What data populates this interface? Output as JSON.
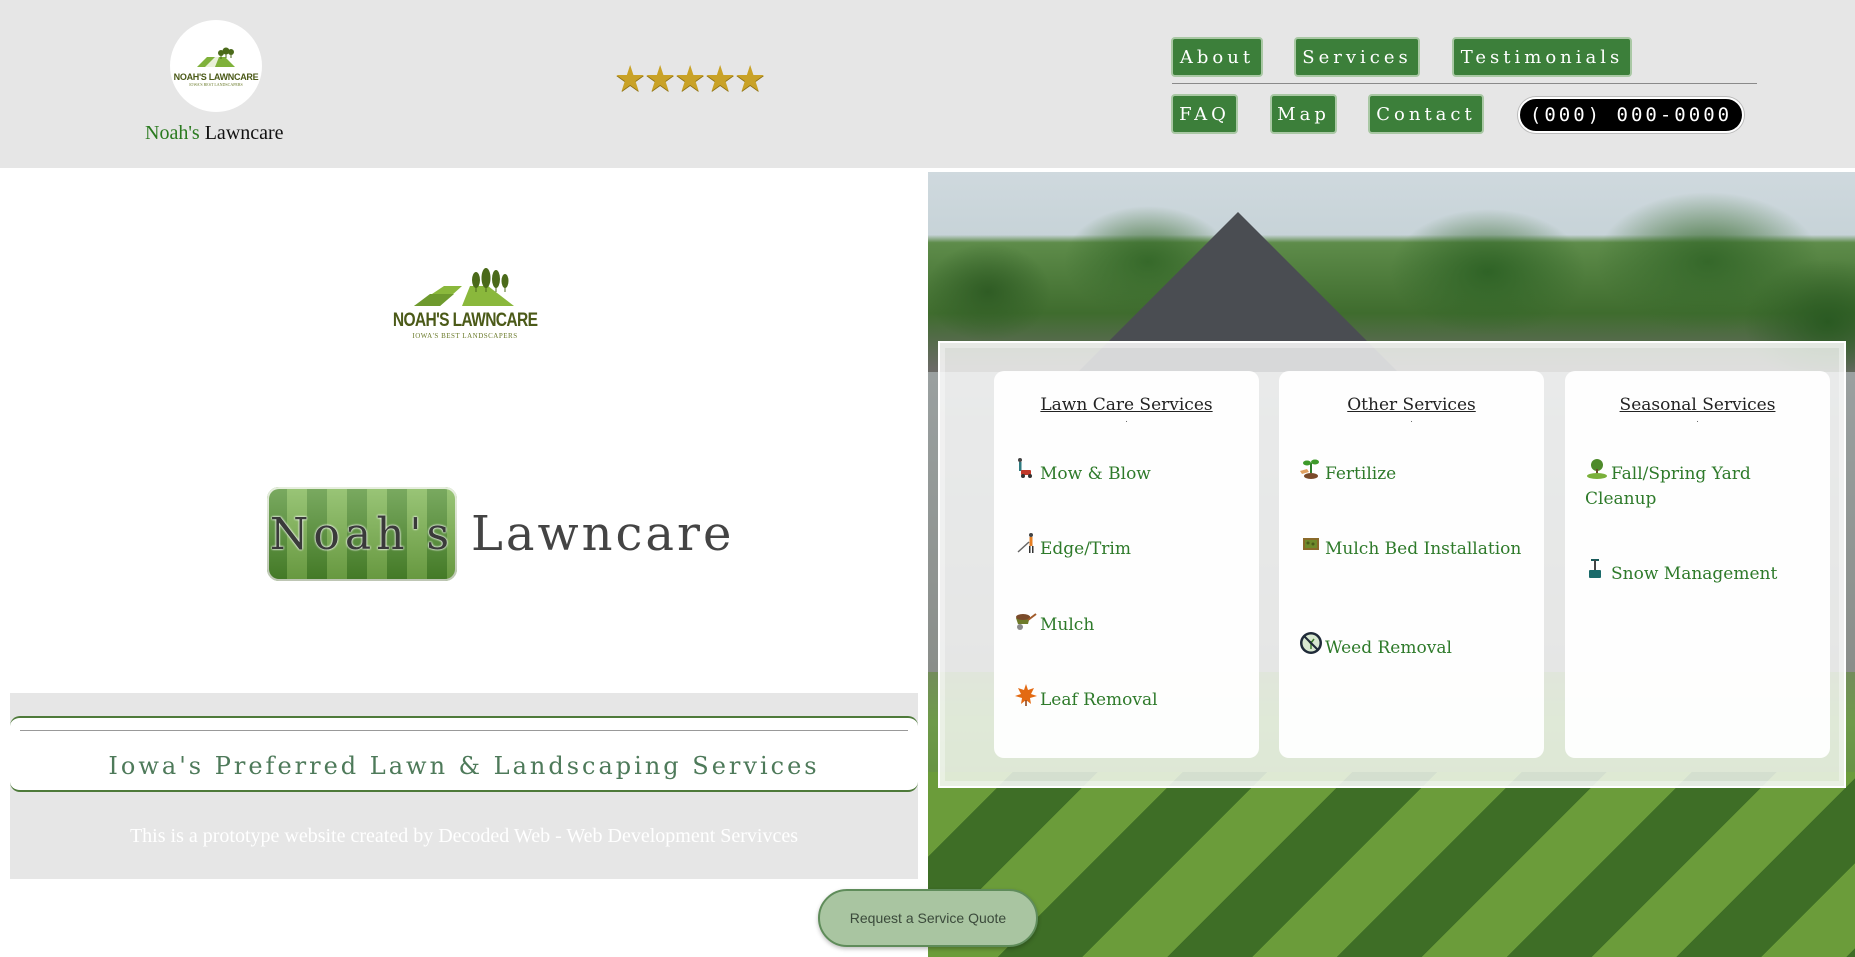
{
  "header": {
    "logo": {
      "mini_text": "NOAH'S LAWNCARE",
      "mini_sub": "IOWA'S BEST LANDSCAPERS"
    },
    "brand_green": "Noah's",
    "brand_black": "Lawncare",
    "stars": [
      "★",
      "★",
      "★",
      "★",
      "★"
    ],
    "nav": {
      "about": "About",
      "services": "Services",
      "testimonials": "Testimonials",
      "faq": "FAQ",
      "map": "Map",
      "contact": "Contact"
    },
    "phone": "(000) 000-0000"
  },
  "left": {
    "big_logo_title": "NOAH'S LAWNCARE",
    "big_logo_sub": "IOWA'S BEST LANDSCAPERS",
    "title_left": "Noah's",
    "title_right": "Lawncare",
    "tagline": "Iowa's Preferred Lawn & Landscaping Services",
    "prototype_note": "This is a prototype website created by Decoded Web - Web Development Servivces",
    "quote_button": "Request a Service Quote"
  },
  "services": {
    "lawn_care": {
      "title": "Lawn Care Services",
      "items": [
        "Mow & Blow",
        "Edge/Trim",
        "Mulch",
        "Leaf Removal"
      ]
    },
    "other": {
      "title": "Other Services",
      "items": [
        "Fertilize",
        "Mulch Bed Installation",
        "Weed Removal"
      ]
    },
    "seasonal": {
      "title": "Seasonal Services",
      "items": [
        "Fall/Spring Yard Cleanup",
        "Snow Management"
      ]
    },
    "dot": "."
  },
  "colors": {
    "nav_green": "#3c7f3a",
    "service_text_green": "#2e7a2a",
    "star_gold": "#c9a227",
    "header_gray": "#e6e6e6"
  }
}
